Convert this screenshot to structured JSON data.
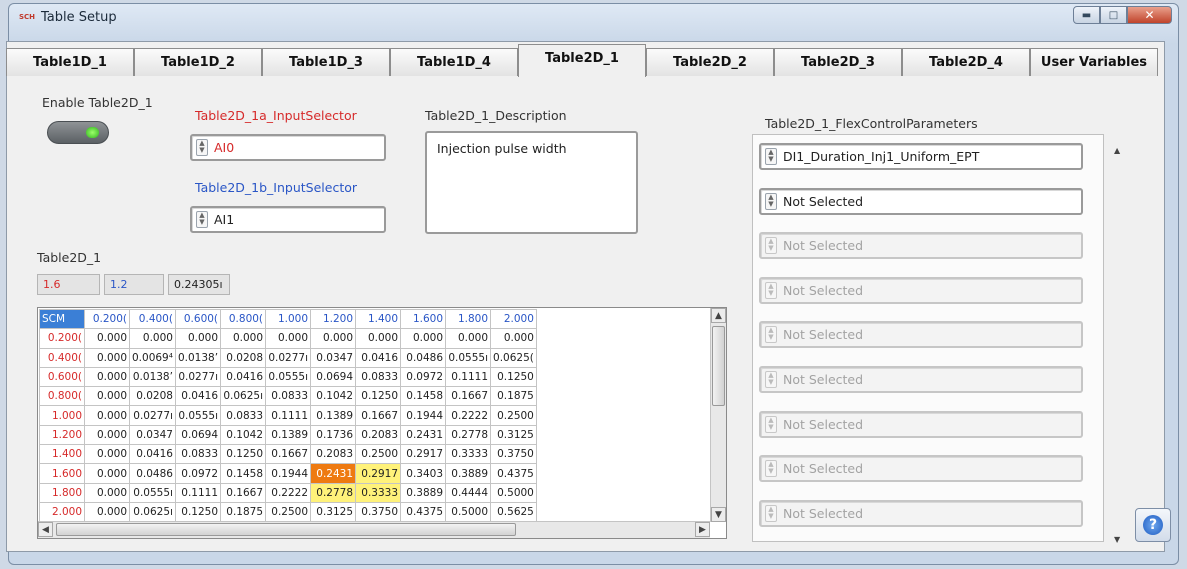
{
  "window": {
    "title": "Table Setup",
    "app_icon_text": "SCH"
  },
  "tabs": [
    "Table1D_1",
    "Table1D_2",
    "Table1D_3",
    "Table1D_4",
    "Table2D_1",
    "Table2D_2",
    "Table2D_3",
    "Table2D_4",
    "User Variables"
  ],
  "active_tab": "Table2D_1",
  "enable": {
    "label": "Enable Table2D_1",
    "state": "on"
  },
  "selector_a": {
    "label": "Table2D_1a_InputSelector",
    "value": "AI0"
  },
  "selector_b": {
    "label": "Table2D_1b_InputSelector",
    "value": "AI1"
  },
  "description": {
    "label": "Table2D_1_Description",
    "value": "Injection pulse width"
  },
  "table": {
    "label": "Table2D_1",
    "index": [
      "1.6",
      "1.2",
      "0.24305ı"
    ],
    "corner": "SCM",
    "columns": [
      "0.200(",
      "0.400(",
      "0.600(",
      "0.800(",
      "1.000",
      "1.200",
      "1.400",
      "1.600",
      "1.800",
      "2.000"
    ],
    "rows": [
      {
        "h": "0.200(",
        "v": [
          "0.000",
          "0.000",
          "0.000",
          "0.000",
          "0.000",
          "0.000",
          "0.000",
          "0.000",
          "0.000",
          "0.000"
        ]
      },
      {
        "h": "0.400(",
        "v": [
          "0.000",
          "0.0069⁴",
          "0.0138’",
          "0.0208",
          "0.0277ı",
          "0.0347",
          "0.0416",
          "0.0486",
          "0.0555ı",
          "0.0625("
        ]
      },
      {
        "h": "0.600(",
        "v": [
          "0.000",
          "0.0138’",
          "0.0277ı",
          "0.0416",
          "0.0555ı",
          "0.0694",
          "0.0833",
          "0.0972",
          "0.1111",
          "0.1250"
        ]
      },
      {
        "h": "0.800(",
        "v": [
          "0.000",
          "0.0208",
          "0.0416",
          "0.0625ı",
          "0.0833",
          "0.1042",
          "0.1250",
          "0.1458",
          "0.1667",
          "0.1875"
        ]
      },
      {
        "h": "1.000",
        "v": [
          "0.000",
          "0.0277ı",
          "0.0555ı",
          "0.0833",
          "0.1111",
          "0.1389",
          "0.1667",
          "0.1944",
          "0.2222",
          "0.2500"
        ]
      },
      {
        "h": "1.200",
        "v": [
          "0.000",
          "0.0347",
          "0.0694",
          "0.1042",
          "0.1389",
          "0.1736",
          "0.2083",
          "0.2431",
          "0.2778",
          "0.3125"
        ]
      },
      {
        "h": "1.400",
        "v": [
          "0.000",
          "0.0416",
          "0.0833",
          "0.1250",
          "0.1667",
          "0.2083",
          "0.2500",
          "0.2917",
          "0.3333",
          "0.3750"
        ]
      },
      {
        "h": "1.600",
        "v": [
          "0.000",
          "0.0486",
          "0.0972",
          "0.1458",
          "0.1944",
          "0.2431",
          "0.2917",
          "0.3403",
          "0.3889",
          "0.4375"
        ]
      },
      {
        "h": "1.800",
        "v": [
          "0.000",
          "0.0555ı",
          "0.1111",
          "0.1667",
          "0.2222",
          "0.2778",
          "0.3333",
          "0.3889",
          "0.4444",
          "0.5000"
        ]
      },
      {
        "h": "2.000",
        "v": [
          "0.000",
          "0.0625ı",
          "0.1250",
          "0.1875",
          "0.2500",
          "0.3125",
          "0.3750",
          "0.4375",
          "0.5000",
          "0.5625"
        ]
      }
    ],
    "highlight": [
      {
        "row": 7,
        "col": 5,
        "color": "#ee7a11"
      },
      {
        "row": 7,
        "col": 6,
        "color": "#fff27a"
      },
      {
        "row": 8,
        "col": 5,
        "color": "#fff27a"
      },
      {
        "row": 8,
        "col": 6,
        "color": "#fff27a"
      }
    ]
  },
  "flex": {
    "label": "Table2D_1_FlexControlParameters",
    "items": [
      "DI1_Duration_Inj1_Uniform_EPT",
      "Not Selected",
      "Not Selected",
      "Not Selected",
      "Not Selected",
      "Not Selected",
      "Not Selected",
      "Not Selected",
      "Not Selected"
    ],
    "enabled_count": 2
  },
  "icons": {
    "help": "help-icon",
    "led": "led-indicator"
  },
  "colors": {
    "accent": "#3b7fd6",
    "highlight_orange": "#ee7a11",
    "highlight_yellow": "#fff27a",
    "label_red": "#d62a2a",
    "label_blue": "#2a56c6"
  }
}
